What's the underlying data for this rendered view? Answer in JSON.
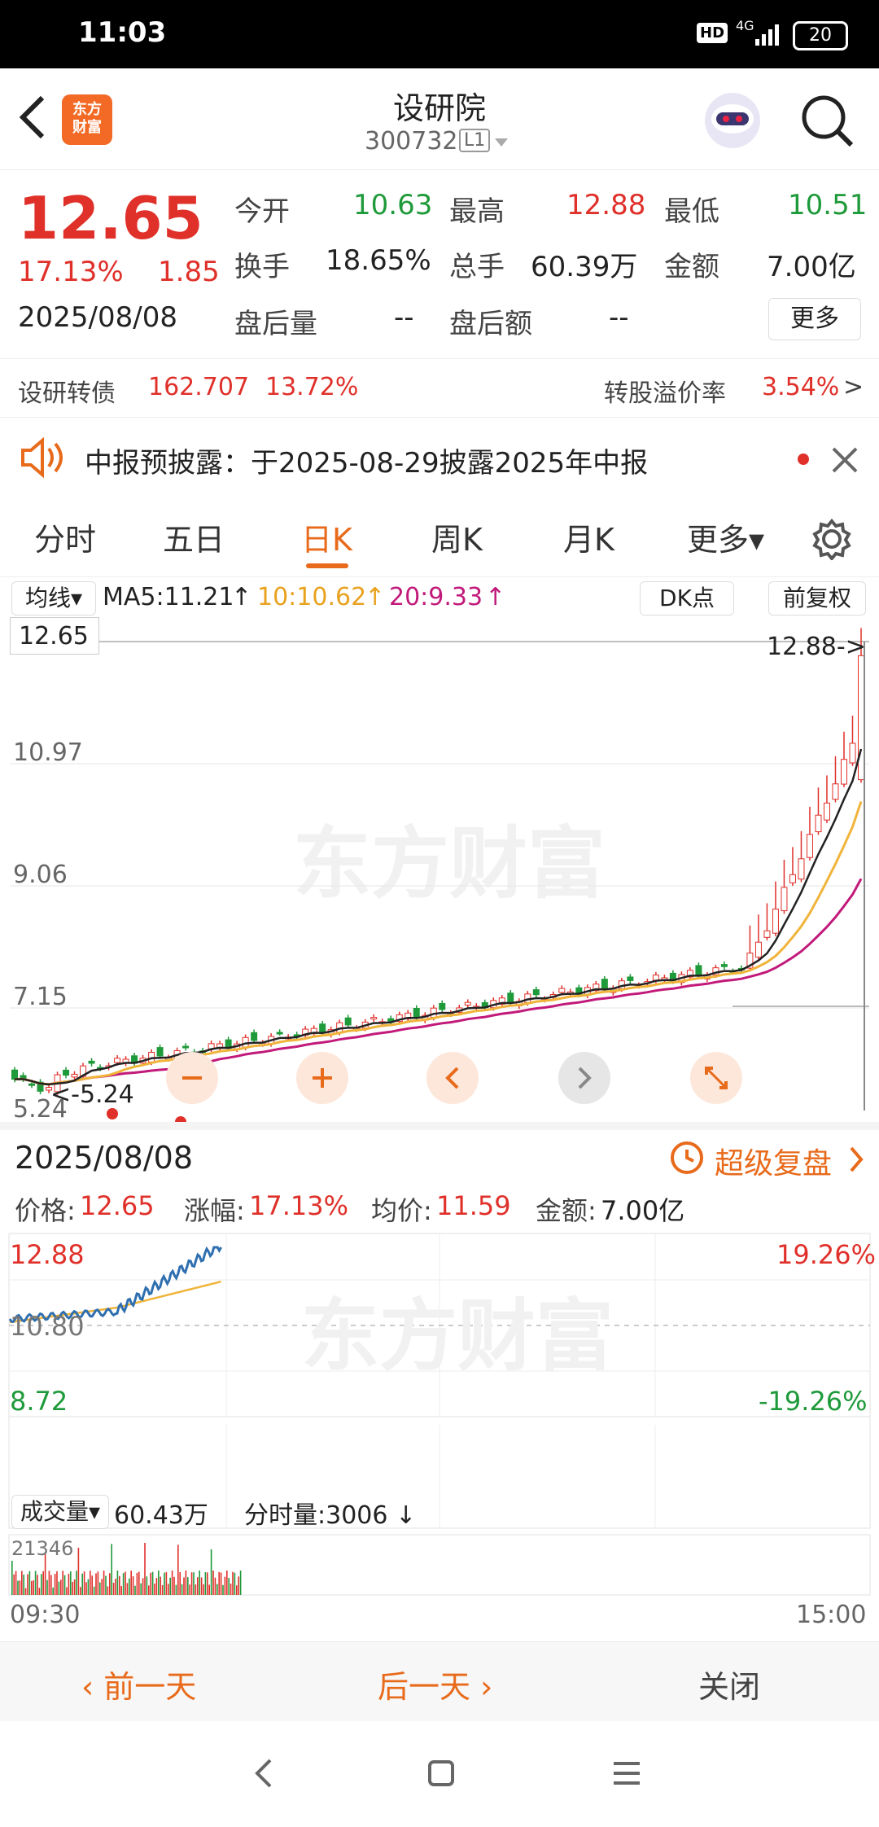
{
  "status": {
    "time": "11:03",
    "hd": "HD",
    "net": "4G",
    "battery": "20"
  },
  "header": {
    "logo": "东方\n财富",
    "title": "设研院",
    "code": "300732",
    "level": "L1"
  },
  "quote": {
    "price": "12.65",
    "pct": "17.13%",
    "change": "1.85",
    "date": "2025/08/08",
    "open_label": "今开",
    "open": "10.63",
    "high_label": "最高",
    "high": "12.88",
    "low_label": "最低",
    "low": "10.51",
    "turnover_label": "换手",
    "turnover": "18.65%",
    "volume_label": "总手",
    "volume": "60.39万",
    "amount_label": "金额",
    "amount": "7.00亿",
    "after_vol_label": "盘后量",
    "after_vol": "--",
    "after_amt_label": "盘后额",
    "after_amt": "--",
    "more": "更多"
  },
  "bond": {
    "name": "设研转债",
    "price": "162.707",
    "pct": "13.72%",
    "premium_label": "转股溢价率",
    "premium": "3.54%",
    "arrow": ">"
  },
  "notice": {
    "text": "中报预披露：于2025-08-29披露2025年中报"
  },
  "tabs": [
    {
      "label": "分时"
    },
    {
      "label": "五日"
    },
    {
      "label": "日K"
    },
    {
      "label": "周K"
    },
    {
      "label": "月K"
    },
    {
      "label": "更多▾"
    }
  ],
  "kline": {
    "indicator": "均线▾",
    "ma5": "MA5:11.21",
    "ma10": "10:10.62",
    "ma20": "20:9.33",
    "arrow": "↑",
    "dk": "DK点",
    "adjust": "前复权",
    "price_box": "12.65",
    "y_labels": [
      "10.97",
      "9.06",
      "7.15",
      "5.24"
    ],
    "high_mark": "12.88->",
    "low_mark": "<-5.24",
    "watermark": "东方财富",
    "colors": {
      "up": "#e0302a",
      "down": "#1f9a3a",
      "ma5": "#222222",
      "ma10": "#f0b43a",
      "ma20": "#c21a7a"
    }
  },
  "detail": {
    "date": "2025/08/08",
    "replay": "超级复盘",
    "price_label": "价格:",
    "price": "12.65",
    "pct_label": "涨幅:",
    "pct": "17.13%",
    "avg_label": "均价:",
    "avg": "11.59",
    "amount_label": "金额:",
    "amount": "7.00亿",
    "y_top": "12.88",
    "y_mid": "10.80",
    "y_bot": "8.72",
    "pct_top": "19.26%",
    "pct_bot": "-19.26%",
    "vol_indicator": "成交量▾",
    "vol_total": "60.43万",
    "vol_min_label": "分时量:3006 ↓",
    "vol_max": "21346",
    "time_start": "09:30",
    "time_end": "15:00",
    "watermark": "东方财富"
  },
  "bottom": {
    "prev": "前一天",
    "next": "后一天",
    "close": "关闭"
  }
}
